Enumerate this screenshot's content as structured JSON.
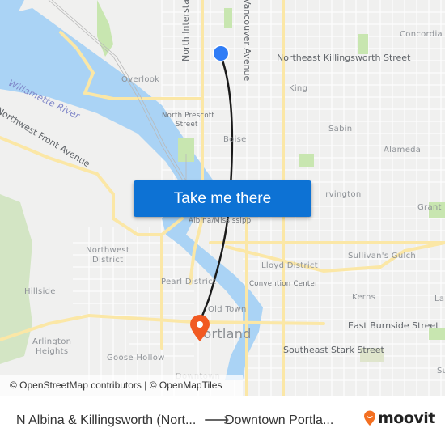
{
  "map": {
    "labels": {
      "north_interstate": "North Interstate",
      "vancouver_avenue": "Vancouver Avenue",
      "concordia": "Concordia",
      "ne_killingsworth": "Northeast Killingsworth Street",
      "overlook": "Overlook",
      "king": "King",
      "willamette_river": "Willamette River",
      "north_prescott": "North Prescott",
      "north_prescott_2": "Street",
      "nw_front_avenue": "Northwest Front Avenue",
      "boise": "Boise",
      "sabin": "Sabin",
      "alameda": "Alameda",
      "irvington": "Irvington",
      "grant": "Grant",
      "albina_mississippi": "Albina/Mississippi",
      "northwest_district_1": "Northwest",
      "northwest_district_2": "District",
      "sullivans_gulch": "Sullivan's Gulch",
      "lloyd_district": "Lloyd District",
      "hillside": "Hillside",
      "pearl_district": "Pearl District",
      "convention_center": "Convention Center",
      "old_town": "Old Town",
      "kerns": "Kerns",
      "laurelhurst_partial": "La",
      "portland": "Portland",
      "e_burnside": "East Burnside Street",
      "arlington_heights_1": "Arlington",
      "arlington_heights_2": "Heights",
      "goose_hollow": "Goose Hollow",
      "se_stark": "Southeast Stark Street",
      "sunnyside_partial": "Su",
      "downtown": "Downtown"
    },
    "origin_marker": "origin-dot",
    "destination_marker": "destination-pin",
    "colors": {
      "water": "#aad3f5",
      "park": "#c8e6b0",
      "major_road": "#fbe7a6",
      "route": "#1a1a1a",
      "origin": "#2f7cf6",
      "destination": "#f15a22",
      "cta": "#0d72d4"
    }
  },
  "cta": {
    "label": "Take me there"
  },
  "attribution": "© OpenStreetMap contributors | © OpenMapTiles",
  "footer": {
    "from": "N Albina & Killingsworth (Nort...",
    "arrow": "⟶",
    "to": "Downtown Portla...",
    "brand": "moovit"
  }
}
